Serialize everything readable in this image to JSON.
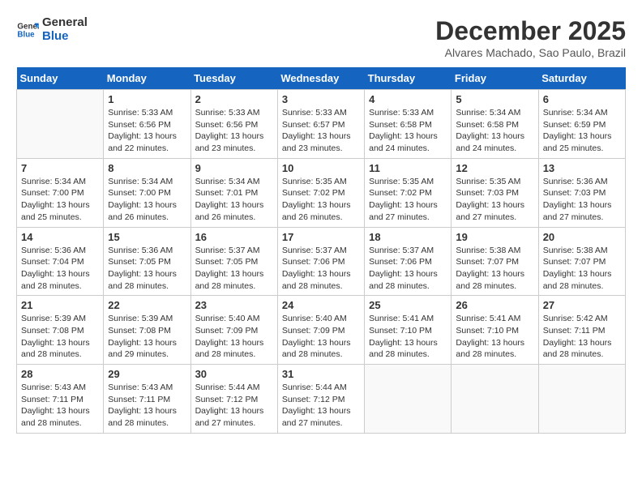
{
  "logo": {
    "line1": "General",
    "line2": "Blue"
  },
  "title": "December 2025",
  "location": "Alvares Machado, Sao Paulo, Brazil",
  "days_of_week": [
    "Sunday",
    "Monday",
    "Tuesday",
    "Wednesday",
    "Thursday",
    "Friday",
    "Saturday"
  ],
  "weeks": [
    [
      {
        "day": "",
        "info": ""
      },
      {
        "day": "1",
        "info": "Sunrise: 5:33 AM\nSunset: 6:56 PM\nDaylight: 13 hours\nand 22 minutes."
      },
      {
        "day": "2",
        "info": "Sunrise: 5:33 AM\nSunset: 6:56 PM\nDaylight: 13 hours\nand 23 minutes."
      },
      {
        "day": "3",
        "info": "Sunrise: 5:33 AM\nSunset: 6:57 PM\nDaylight: 13 hours\nand 23 minutes."
      },
      {
        "day": "4",
        "info": "Sunrise: 5:33 AM\nSunset: 6:58 PM\nDaylight: 13 hours\nand 24 minutes."
      },
      {
        "day": "5",
        "info": "Sunrise: 5:34 AM\nSunset: 6:58 PM\nDaylight: 13 hours\nand 24 minutes."
      },
      {
        "day": "6",
        "info": "Sunrise: 5:34 AM\nSunset: 6:59 PM\nDaylight: 13 hours\nand 25 minutes."
      }
    ],
    [
      {
        "day": "7",
        "info": ""
      },
      {
        "day": "8",
        "info": "Sunrise: 5:34 AM\nSunset: 7:00 PM\nDaylight: 13 hours\nand 26 minutes."
      },
      {
        "day": "9",
        "info": "Sunrise: 5:34 AM\nSunset: 7:01 PM\nDaylight: 13 hours\nand 26 minutes."
      },
      {
        "day": "10",
        "info": "Sunrise: 5:35 AM\nSunset: 7:02 PM\nDaylight: 13 hours\nand 26 minutes."
      },
      {
        "day": "11",
        "info": "Sunrise: 5:35 AM\nSunset: 7:02 PM\nDaylight: 13 hours\nand 27 minutes."
      },
      {
        "day": "12",
        "info": "Sunrise: 5:35 AM\nSunset: 7:03 PM\nDaylight: 13 hours\nand 27 minutes."
      },
      {
        "day": "13",
        "info": "Sunrise: 5:36 AM\nSunset: 7:03 PM\nDaylight: 13 hours\nand 27 minutes."
      }
    ],
    [
      {
        "day": "14",
        "info": ""
      },
      {
        "day": "15",
        "info": "Sunrise: 5:36 AM\nSunset: 7:05 PM\nDaylight: 13 hours\nand 28 minutes."
      },
      {
        "day": "16",
        "info": "Sunrise: 5:37 AM\nSunset: 7:05 PM\nDaylight: 13 hours\nand 28 minutes."
      },
      {
        "day": "17",
        "info": "Sunrise: 5:37 AM\nSunset: 7:06 PM\nDaylight: 13 hours\nand 28 minutes."
      },
      {
        "day": "18",
        "info": "Sunrise: 5:37 AM\nSunset: 7:06 PM\nDaylight: 13 hours\nand 28 minutes."
      },
      {
        "day": "19",
        "info": "Sunrise: 5:38 AM\nSunset: 7:07 PM\nDaylight: 13 hours\nand 28 minutes."
      },
      {
        "day": "20",
        "info": "Sunrise: 5:38 AM\nSunset: 7:07 PM\nDaylight: 13 hours\nand 28 minutes."
      }
    ],
    [
      {
        "day": "21",
        "info": ""
      },
      {
        "day": "22",
        "info": "Sunrise: 5:39 AM\nSunset: 7:08 PM\nDaylight: 13 hours\nand 29 minutes."
      },
      {
        "day": "23",
        "info": "Sunrise: 5:40 AM\nSunset: 7:09 PM\nDaylight: 13 hours\nand 28 minutes."
      },
      {
        "day": "24",
        "info": "Sunrise: 5:40 AM\nSunset: 7:09 PM\nDaylight: 13 hours\nand 28 minutes."
      },
      {
        "day": "25",
        "info": "Sunrise: 5:41 AM\nSunset: 7:10 PM\nDaylight: 13 hours\nand 28 minutes."
      },
      {
        "day": "26",
        "info": "Sunrise: 5:41 AM\nSunset: 7:10 PM\nDaylight: 13 hours\nand 28 minutes."
      },
      {
        "day": "27",
        "info": "Sunrise: 5:42 AM\nSunset: 7:11 PM\nDaylight: 13 hours\nand 28 minutes."
      }
    ],
    [
      {
        "day": "28",
        "info": "Sunrise: 5:43 AM\nSunset: 7:11 PM\nDaylight: 13 hours\nand 28 minutes."
      },
      {
        "day": "29",
        "info": "Sunrise: 5:43 AM\nSunset: 7:11 PM\nDaylight: 13 hours\nand 28 minutes."
      },
      {
        "day": "30",
        "info": "Sunrise: 5:44 AM\nSunset: 7:12 PM\nDaylight: 13 hours\nand 27 minutes."
      },
      {
        "day": "31",
        "info": "Sunrise: 5:44 AM\nSunset: 7:12 PM\nDaylight: 13 hours\nand 27 minutes."
      },
      {
        "day": "",
        "info": ""
      },
      {
        "day": "",
        "info": ""
      },
      {
        "day": "",
        "info": ""
      }
    ]
  ],
  "week1_day7_info": "Sunrise: 5:34 AM\nSunset: 7:00 PM\nDaylight: 13 hours\nand 25 minutes.",
  "week2_day14_info": "Sunrise: 5:36 AM\nSunset: 7:04 PM\nDaylight: 13 hours\nand 28 minutes.",
  "week3_day21_info": "Sunrise: 5:39 AM\nSunset: 7:08 PM\nDaylight: 13 hours\nand 28 minutes."
}
